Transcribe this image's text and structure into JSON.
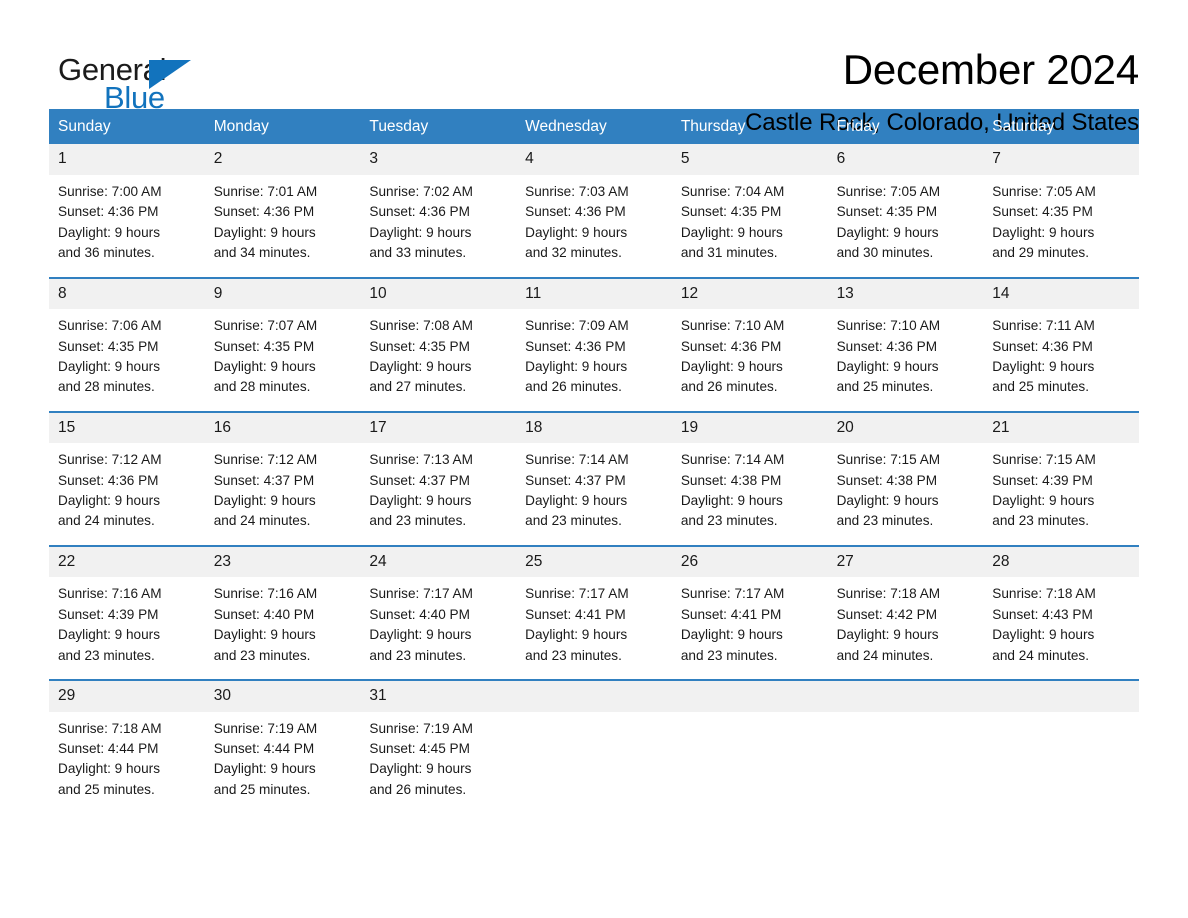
{
  "logo": {
    "word_general": "General",
    "word_blue": "Blue",
    "triangle_color": "#1273bd"
  },
  "header": {
    "title": "December 2024",
    "subtitle": "Castle Rock, Colorado, United States"
  },
  "theme": {
    "header_blue": "#3180c0",
    "daynum_band": "#f1f1f1",
    "text": "#1a1a1a"
  },
  "calendar": {
    "day_headers": [
      "Sunday",
      "Monday",
      "Tuesday",
      "Wednesday",
      "Thursday",
      "Friday",
      "Saturday"
    ],
    "weeks": [
      {
        "daynums": [
          "1",
          "2",
          "3",
          "4",
          "5",
          "6",
          "7"
        ],
        "cells": [
          {
            "sunrise": "Sunrise: 7:00 AM",
            "sunset": "Sunset: 4:36 PM",
            "daylight1": "Daylight: 9 hours",
            "daylight2": "and 36 minutes."
          },
          {
            "sunrise": "Sunrise: 7:01 AM",
            "sunset": "Sunset: 4:36 PM",
            "daylight1": "Daylight: 9 hours",
            "daylight2": "and 34 minutes."
          },
          {
            "sunrise": "Sunrise: 7:02 AM",
            "sunset": "Sunset: 4:36 PM",
            "daylight1": "Daylight: 9 hours",
            "daylight2": "and 33 minutes."
          },
          {
            "sunrise": "Sunrise: 7:03 AM",
            "sunset": "Sunset: 4:36 PM",
            "daylight1": "Daylight: 9 hours",
            "daylight2": "and 32 minutes."
          },
          {
            "sunrise": "Sunrise: 7:04 AM",
            "sunset": "Sunset: 4:35 PM",
            "daylight1": "Daylight: 9 hours",
            "daylight2": "and 31 minutes."
          },
          {
            "sunrise": "Sunrise: 7:05 AM",
            "sunset": "Sunset: 4:35 PM",
            "daylight1": "Daylight: 9 hours",
            "daylight2": "and 30 minutes."
          },
          {
            "sunrise": "Sunrise: 7:05 AM",
            "sunset": "Sunset: 4:35 PM",
            "daylight1": "Daylight: 9 hours",
            "daylight2": "and 29 minutes."
          }
        ]
      },
      {
        "daynums": [
          "8",
          "9",
          "10",
          "11",
          "12",
          "13",
          "14"
        ],
        "cells": [
          {
            "sunrise": "Sunrise: 7:06 AM",
            "sunset": "Sunset: 4:35 PM",
            "daylight1": "Daylight: 9 hours",
            "daylight2": "and 28 minutes."
          },
          {
            "sunrise": "Sunrise: 7:07 AM",
            "sunset": "Sunset: 4:35 PM",
            "daylight1": "Daylight: 9 hours",
            "daylight2": "and 28 minutes."
          },
          {
            "sunrise": "Sunrise: 7:08 AM",
            "sunset": "Sunset: 4:35 PM",
            "daylight1": "Daylight: 9 hours",
            "daylight2": "and 27 minutes."
          },
          {
            "sunrise": "Sunrise: 7:09 AM",
            "sunset": "Sunset: 4:36 PM",
            "daylight1": "Daylight: 9 hours",
            "daylight2": "and 26 minutes."
          },
          {
            "sunrise": "Sunrise: 7:10 AM",
            "sunset": "Sunset: 4:36 PM",
            "daylight1": "Daylight: 9 hours",
            "daylight2": "and 26 minutes."
          },
          {
            "sunrise": "Sunrise: 7:10 AM",
            "sunset": "Sunset: 4:36 PM",
            "daylight1": "Daylight: 9 hours",
            "daylight2": "and 25 minutes."
          },
          {
            "sunrise": "Sunrise: 7:11 AM",
            "sunset": "Sunset: 4:36 PM",
            "daylight1": "Daylight: 9 hours",
            "daylight2": "and 25 minutes."
          }
        ]
      },
      {
        "daynums": [
          "15",
          "16",
          "17",
          "18",
          "19",
          "20",
          "21"
        ],
        "cells": [
          {
            "sunrise": "Sunrise: 7:12 AM",
            "sunset": "Sunset: 4:36 PM",
            "daylight1": "Daylight: 9 hours",
            "daylight2": "and 24 minutes."
          },
          {
            "sunrise": "Sunrise: 7:12 AM",
            "sunset": "Sunset: 4:37 PM",
            "daylight1": "Daylight: 9 hours",
            "daylight2": "and 24 minutes."
          },
          {
            "sunrise": "Sunrise: 7:13 AM",
            "sunset": "Sunset: 4:37 PM",
            "daylight1": "Daylight: 9 hours",
            "daylight2": "and 23 minutes."
          },
          {
            "sunrise": "Sunrise: 7:14 AM",
            "sunset": "Sunset: 4:37 PM",
            "daylight1": "Daylight: 9 hours",
            "daylight2": "and 23 minutes."
          },
          {
            "sunrise": "Sunrise: 7:14 AM",
            "sunset": "Sunset: 4:38 PM",
            "daylight1": "Daylight: 9 hours",
            "daylight2": "and 23 minutes."
          },
          {
            "sunrise": "Sunrise: 7:15 AM",
            "sunset": "Sunset: 4:38 PM",
            "daylight1": "Daylight: 9 hours",
            "daylight2": "and 23 minutes."
          },
          {
            "sunrise": "Sunrise: 7:15 AM",
            "sunset": "Sunset: 4:39 PM",
            "daylight1": "Daylight: 9 hours",
            "daylight2": "and 23 minutes."
          }
        ]
      },
      {
        "daynums": [
          "22",
          "23",
          "24",
          "25",
          "26",
          "27",
          "28"
        ],
        "cells": [
          {
            "sunrise": "Sunrise: 7:16 AM",
            "sunset": "Sunset: 4:39 PM",
            "daylight1": "Daylight: 9 hours",
            "daylight2": "and 23 minutes."
          },
          {
            "sunrise": "Sunrise: 7:16 AM",
            "sunset": "Sunset: 4:40 PM",
            "daylight1": "Daylight: 9 hours",
            "daylight2": "and 23 minutes."
          },
          {
            "sunrise": "Sunrise: 7:17 AM",
            "sunset": "Sunset: 4:40 PM",
            "daylight1": "Daylight: 9 hours",
            "daylight2": "and 23 minutes."
          },
          {
            "sunrise": "Sunrise: 7:17 AM",
            "sunset": "Sunset: 4:41 PM",
            "daylight1": "Daylight: 9 hours",
            "daylight2": "and 23 minutes."
          },
          {
            "sunrise": "Sunrise: 7:17 AM",
            "sunset": "Sunset: 4:41 PM",
            "daylight1": "Daylight: 9 hours",
            "daylight2": "and 23 minutes."
          },
          {
            "sunrise": "Sunrise: 7:18 AM",
            "sunset": "Sunset: 4:42 PM",
            "daylight1": "Daylight: 9 hours",
            "daylight2": "and 24 minutes."
          },
          {
            "sunrise": "Sunrise: 7:18 AM",
            "sunset": "Sunset: 4:43 PM",
            "daylight1": "Daylight: 9 hours",
            "daylight2": "and 24 minutes."
          }
        ]
      },
      {
        "daynums": [
          "29",
          "30",
          "31",
          "",
          "",
          "",
          ""
        ],
        "cells": [
          {
            "sunrise": "Sunrise: 7:18 AM",
            "sunset": "Sunset: 4:44 PM",
            "daylight1": "Daylight: 9 hours",
            "daylight2": "and 25 minutes."
          },
          {
            "sunrise": "Sunrise: 7:19 AM",
            "sunset": "Sunset: 4:44 PM",
            "daylight1": "Daylight: 9 hours",
            "daylight2": "and 25 minutes."
          },
          {
            "sunrise": "Sunrise: 7:19 AM",
            "sunset": "Sunset: 4:45 PM",
            "daylight1": "Daylight: 9 hours",
            "daylight2": "and 26 minutes."
          },
          {
            "sunrise": "",
            "sunset": "",
            "daylight1": "",
            "daylight2": ""
          },
          {
            "sunrise": "",
            "sunset": "",
            "daylight1": "",
            "daylight2": ""
          },
          {
            "sunrise": "",
            "sunset": "",
            "daylight1": "",
            "daylight2": ""
          },
          {
            "sunrise": "",
            "sunset": "",
            "daylight1": "",
            "daylight2": ""
          }
        ]
      }
    ]
  }
}
